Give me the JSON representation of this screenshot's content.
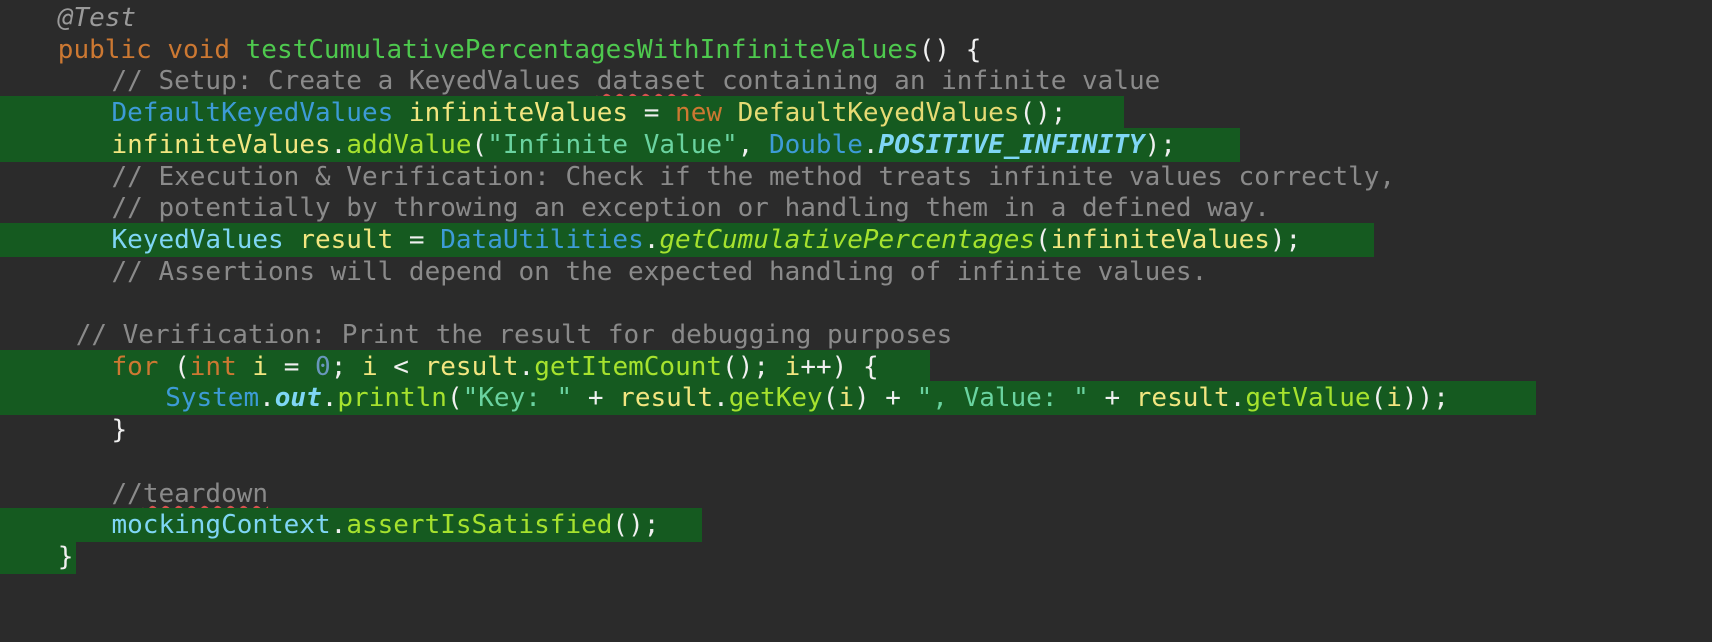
{
  "code_lines": [
    {
      "indent": 2,
      "highlight": false,
      "tokens": [
        {
          "c": "ann",
          "t": "@Test"
        }
      ]
    },
    {
      "indent": 2,
      "highlight": false,
      "tokens": [
        {
          "c": "kw",
          "t": "public void "
        },
        {
          "c": "mth",
          "t": "testCumulativePercentagesWithInfiniteValues"
        },
        {
          "c": "pun",
          "t": "() {"
        }
      ]
    },
    {
      "indent": 5,
      "highlight": false,
      "tokens": [
        {
          "c": "cmt",
          "t": "// Setup: Create a KeyedValues "
        },
        {
          "c": "cmt spell",
          "t": "dataset"
        },
        {
          "c": "cmt",
          "t": " containing an infinite value"
        }
      ]
    },
    {
      "indent": 5,
      "highlight": true,
      "hl_end": 1124,
      "tokens": [
        {
          "c": "typ",
          "t": "DefaultKeyedValues "
        },
        {
          "c": "var",
          "t": "infiniteValues"
        },
        {
          "c": "pun",
          "t": " = "
        },
        {
          "c": "kw",
          "t": "new "
        },
        {
          "c": "cls",
          "t": "DefaultKeyedValues"
        },
        {
          "c": "pun",
          "t": "();"
        }
      ]
    },
    {
      "indent": 5,
      "highlight": true,
      "hl_end": 1240,
      "tokens": [
        {
          "c": "var",
          "t": "infiniteValues"
        },
        {
          "c": "pun",
          "t": "."
        },
        {
          "c": "mc",
          "t": "addValue"
        },
        {
          "c": "pun",
          "t": "("
        },
        {
          "c": "str",
          "t": "\"Infinite Value\""
        },
        {
          "c": "pun",
          "t": ", "
        },
        {
          "c": "typ",
          "t": "Double"
        },
        {
          "c": "pun",
          "t": "."
        },
        {
          "c": "cst",
          "t": "POSITIVE_INFINITY"
        },
        {
          "c": "pun",
          "t": ");"
        }
      ]
    },
    {
      "indent": 5,
      "highlight": false,
      "tokens": [
        {
          "c": "cmt",
          "t": "// Execution & Verification: Check if the method treats infinite values correctly,"
        }
      ]
    },
    {
      "indent": 5,
      "highlight": false,
      "tokens": [
        {
          "c": "cmt",
          "t": "// potentially by throwing an exception or handling them in a defined way."
        }
      ]
    },
    {
      "indent": 5,
      "highlight": true,
      "hl_end": 1374,
      "tokens": [
        {
          "c": "vlt",
          "t": "KeyedValues "
        },
        {
          "c": "var",
          "t": "result"
        },
        {
          "c": "pun",
          "t": " = "
        },
        {
          "c": "typ",
          "t": "DataUtilities"
        },
        {
          "c": "pun",
          "t": "."
        },
        {
          "c": "sta",
          "t": "getCumulativePercentages"
        },
        {
          "c": "pun",
          "t": "("
        },
        {
          "c": "var",
          "t": "infiniteValues"
        },
        {
          "c": "pun",
          "t": ");"
        }
      ]
    },
    {
      "indent": 5,
      "highlight": false,
      "tokens": [
        {
          "c": "cmt",
          "t": "// Assertions will depend on the expected handling of infinite values."
        }
      ]
    },
    {
      "indent": 0,
      "highlight": false,
      "tokens": []
    },
    {
      "indent": 3,
      "highlight": false,
      "tokens": [
        {
          "c": "cmt",
          "t": "// Verification: Print the result for debugging purposes"
        }
      ]
    },
    {
      "indent": 5,
      "highlight": true,
      "hl_end": 930,
      "tokens": [
        {
          "c": "kw",
          "t": "for "
        },
        {
          "c": "pun",
          "t": "("
        },
        {
          "c": "kw",
          "t": "int "
        },
        {
          "c": "var",
          "t": "i"
        },
        {
          "c": "pun",
          "t": " = "
        },
        {
          "c": "num",
          "t": "0"
        },
        {
          "c": "pun",
          "t": "; "
        },
        {
          "c": "var",
          "t": "i"
        },
        {
          "c": "pun",
          "t": " < "
        },
        {
          "c": "var",
          "t": "result"
        },
        {
          "c": "pun",
          "t": "."
        },
        {
          "c": "mc",
          "t": "getItemCount"
        },
        {
          "c": "pun",
          "t": "(); "
        },
        {
          "c": "var",
          "t": "i"
        },
        {
          "c": "pun",
          "t": "++) {"
        }
      ]
    },
    {
      "indent": 8,
      "highlight": true,
      "hl_end": 1536,
      "tokens": [
        {
          "c": "typ",
          "t": "System"
        },
        {
          "c": "pun",
          "t": "."
        },
        {
          "c": "cst",
          "t": "out"
        },
        {
          "c": "pun",
          "t": "."
        },
        {
          "c": "mc",
          "t": "println"
        },
        {
          "c": "pun",
          "t": "("
        },
        {
          "c": "str",
          "t": "\"Key: \""
        },
        {
          "c": "pun",
          "t": " + "
        },
        {
          "c": "var",
          "t": "result"
        },
        {
          "c": "pun",
          "t": "."
        },
        {
          "c": "mc",
          "t": "getKey"
        },
        {
          "c": "pun",
          "t": "("
        },
        {
          "c": "var",
          "t": "i"
        },
        {
          "c": "pun",
          "t": ") + "
        },
        {
          "c": "str",
          "t": "\", Value: \""
        },
        {
          "c": "pun",
          "t": " + "
        },
        {
          "c": "var",
          "t": "result"
        },
        {
          "c": "pun",
          "t": "."
        },
        {
          "c": "mc",
          "t": "getValue"
        },
        {
          "c": "pun",
          "t": "("
        },
        {
          "c": "var",
          "t": "i"
        },
        {
          "c": "pun",
          "t": "));"
        }
      ]
    },
    {
      "indent": 5,
      "highlight": false,
      "tokens": [
        {
          "c": "pun",
          "t": "}"
        }
      ]
    },
    {
      "indent": 0,
      "highlight": false,
      "tokens": []
    },
    {
      "indent": 5,
      "highlight": false,
      "tokens": [
        {
          "c": "cmt",
          "t": "//"
        },
        {
          "c": "cmt spell",
          "t": "teardown"
        }
      ]
    },
    {
      "indent": 5,
      "highlight": true,
      "hl_end": 702,
      "tokens": [
        {
          "c": "vlt",
          "t": "mockingContext"
        },
        {
          "c": "pun",
          "t": "."
        },
        {
          "c": "mc",
          "t": "assertIsSatisfied"
        },
        {
          "c": "pun",
          "t": "();"
        }
      ]
    },
    {
      "indent": 2,
      "highlight": true,
      "hl_end": 76,
      "tokens": [
        {
          "c": "pun",
          "t": "}"
        }
      ]
    }
  ]
}
